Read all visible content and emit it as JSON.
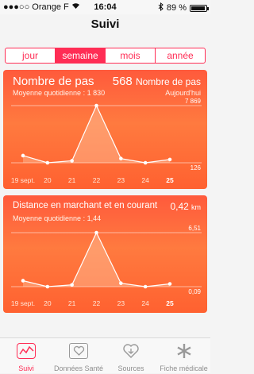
{
  "status_bar": {
    "carrier": "Orange F",
    "time": "16:04",
    "battery": "89 %"
  },
  "nav": {
    "title": "Suivi"
  },
  "segments": [
    {
      "label": "jour",
      "active": false
    },
    {
      "label": "semaine",
      "active": true
    },
    {
      "label": "mois",
      "active": false
    },
    {
      "label": "année",
      "active": false
    }
  ],
  "cards": [
    {
      "title": "Nombre de pas",
      "value": "568",
      "unit": "Nombre de pas",
      "subtitle": "Moyenne quotidienne : 1 830",
      "subtitle_right": "Aujourd'hui",
      "y_max_label": "7 869",
      "y_min_label": "126",
      "chart_data": {
        "type": "line",
        "x": [
          "19 sept.",
          "20",
          "21",
          "22",
          "23",
          "24",
          "25"
        ],
        "y": [
          1100,
          126,
          400,
          7869,
          700,
          126,
          568
        ],
        "ylim": [
          126,
          7869
        ]
      }
    },
    {
      "title": "Distance en marchant et en courant",
      "value": "0,42",
      "unit": "km",
      "subtitle": "Moyenne quotidienne : 1,44",
      "subtitle_right": "",
      "y_max_label": "6,51",
      "y_min_label": "0,09",
      "chart_data": {
        "type": "line",
        "x": [
          "19 sept.",
          "20",
          "21",
          "22",
          "23",
          "24",
          "25"
        ],
        "y": [
          0.8,
          0.09,
          0.3,
          6.51,
          0.5,
          0.09,
          0.42
        ],
        "ylim": [
          0.09,
          6.51
        ]
      }
    }
  ],
  "tabbar": [
    {
      "label": "Suivi",
      "icon": "suivi-icon",
      "active": true
    },
    {
      "label": "Données Santé",
      "icon": "health-data-icon",
      "active": false
    },
    {
      "label": "Sources",
      "icon": "sources-icon",
      "active": false
    },
    {
      "label": "Fiche médicale",
      "icon": "medical-id-icon",
      "active": false
    }
  ],
  "colors": {
    "accent": "#ff2d55",
    "card_top": "#ff5a3c",
    "card_mid": "#ff7a3f"
  }
}
